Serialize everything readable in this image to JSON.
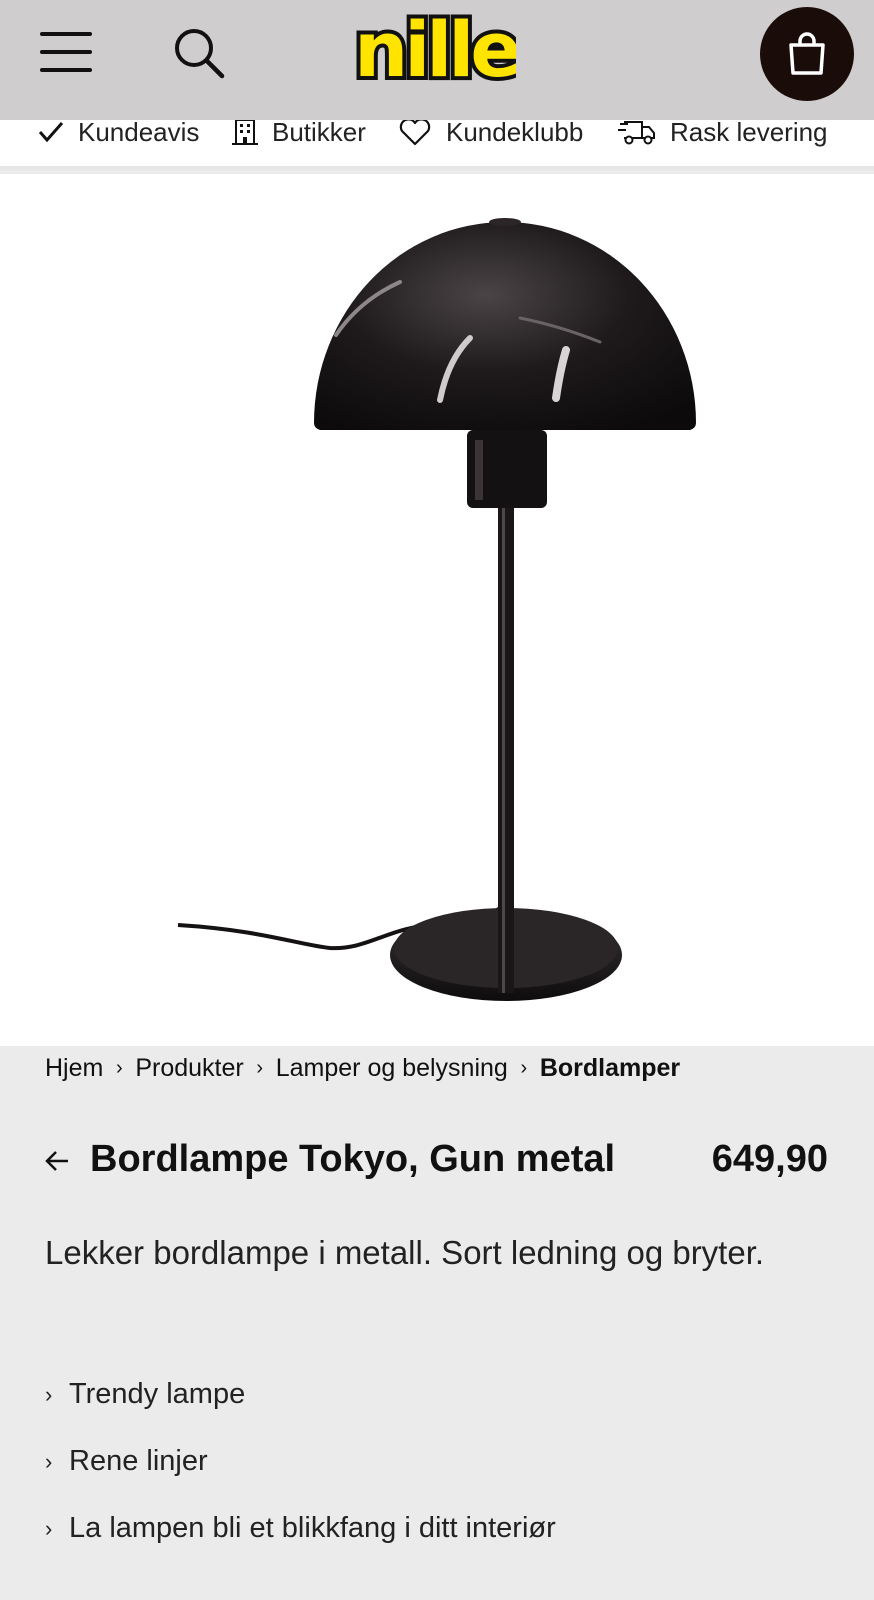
{
  "header": {
    "logo_text": "nille",
    "brand_color": "#ffe400",
    "menu_icon": "hamburger-menu-icon",
    "search_icon": "search-icon",
    "cart_icon": "shopping-bag-icon"
  },
  "usp_bar": {
    "items": [
      {
        "label": "Kundeavis",
        "icon": "checkmark-icon"
      },
      {
        "label": "Butikker",
        "icon": "building-icon"
      },
      {
        "label": "Kundeklubb",
        "icon": "heart-icon"
      },
      {
        "label": "Rask levering",
        "icon": "delivery-truck-icon"
      }
    ]
  },
  "product_image": {
    "subject": "black mushroom-shaped table lamp with cord"
  },
  "breadcrumb": {
    "items": [
      "Hjem",
      "Produkter",
      "Lamper og belysning",
      "Bordlamper"
    ],
    "separator": "›"
  },
  "product": {
    "title": "Bordlampe Tokyo, Gun metal",
    "price": "649,90",
    "description": "Lekker bordlampe i metall. Sort ledning og bryter.",
    "features": [
      "Trendy lampe",
      "Rene linjer",
      "La lampen bli et blikkfang i ditt interiør"
    ]
  }
}
